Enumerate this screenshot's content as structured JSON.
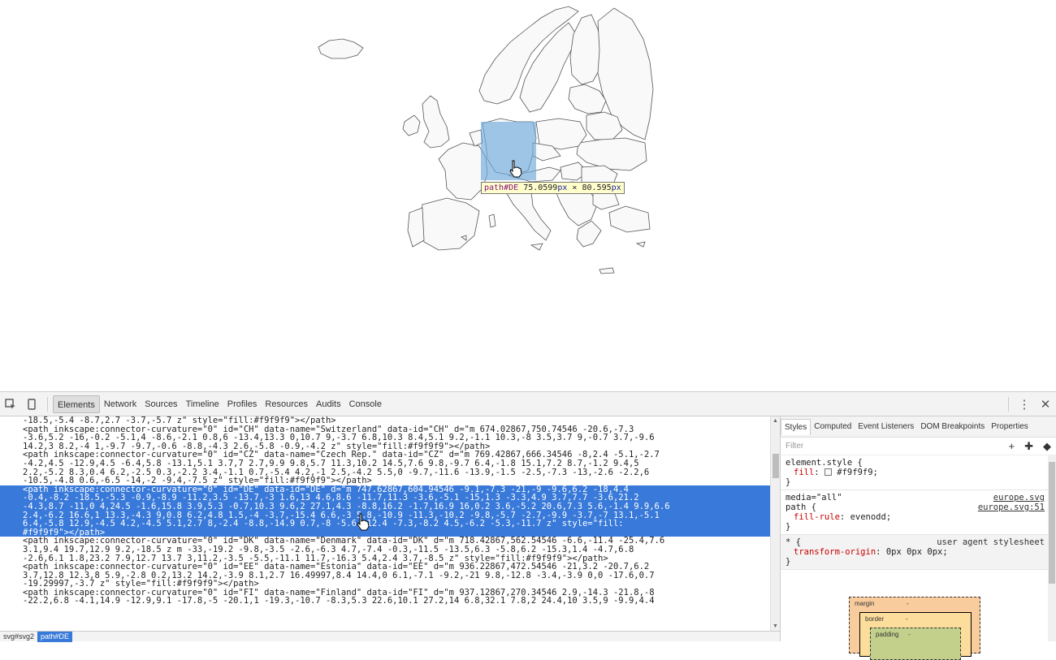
{
  "tooltip": {
    "tag": "path#DE",
    "width": "75.0599",
    "px1": "px",
    "times": "×",
    "height": "80.595",
    "px2": "px"
  },
  "toolbar": {
    "tabs": [
      "Elements",
      "Network",
      "Sources",
      "Timeline",
      "Profiles",
      "Resources",
      "Audits",
      "Console"
    ],
    "active_tab": "Elements",
    "icons": {
      "inspect": "inspect-icon",
      "device": "device-mode-icon",
      "more": "more-vert-icon",
      "close": "close-icon"
    }
  },
  "dom_lines": [
    {
      "text": "-18.5,-5.4 -8.7,2.7 -3.7,-5.7 z\" style=\"fill:#f9f9f9\"></path>",
      "selected": false
    },
    {
      "text": "<path inkscape:connector-curvature=\"0\" id=\"CH\" data-name=\"Switzerland\" data-id=\"CH\" d=\"m 674.02867,750.74546 -20.6,-7.3",
      "selected": false
    },
    {
      "text": "-3.6,5.2 -16,-0.2 -5.1,4 -8.6,-2.1 0.8,6 -13.4,13.3 0,10.7 9,-3.7 6.8,10.3 8.4,5.1 9.2,-1.1 10.3,-8 3.5,3.7 9,-0.7 3.7,-9.6",
      "selected": false
    },
    {
      "text": "14.2,3 8.2,-4 1,-9.7 -9.7,-0.6 -8.8,-4.3 2.6,-5.8 -0.9,-4.2 z\" style=\"fill:#f9f9f9\"></path>",
      "selected": false
    },
    {
      "text": "<path inkscape:connector-curvature=\"0\" id=\"CZ\" data-name=\"Czech Rep.\" data-id=\"CZ\" d=\"m 769.42867,666.34546 -8,2.4 -5.1,-2.7",
      "selected": false
    },
    {
      "text": "-4.2,4.5 -12.9,4.5 -6.4,5.8 -13.1,5.1 3.7,7 2.7,9.9 9.8,5.7 11.3,10.2 14.5,7.6 9.8,-9.7 6.4,-1.8 15.1,7.2 8.7,-1.2 9.4,5",
      "selected": false
    },
    {
      "text": "2.2,-5.2 8.3,0.4 6.2,-2.5 0.3,-2.2 3.4,-1.1 0.7,-5.4 4.2,-1 2.5,-4.2 5.5,0 -9.7,-11.6 -13.9,-1.5 -2.5,-7.3 -13,-2.6 -2.2,6",
      "selected": false
    },
    {
      "text": "-10.5,-4.8 0.6,-6.5 -14,-2 -9.4,-7.5 z\" style=\"fill:#f9f9f9\"></path>",
      "selected": false
    },
    {
      "text": "<path inkscape:connector-curvature=\"0\" id=\"DE\" data-id=\"DE\" d=\"m 747.62867,604.94546 -9.1,-7.3 -21,-9 -9.6,6.2 -18,4.4",
      "selected": true
    },
    {
      "text": "-0.4,-8.2 -18.5,-5.3 -0.9,-8.9 -11.2,3.5 -13.7,-3 1.6,13 4.6,8.6 -11.7,11.3 -3.6,-5.1 -15,1.3 -3.3,4.9 3.7,7.7 -3.6,21.2",
      "selected": true
    },
    {
      "text": "-4.3,8.7 -11,0 4,24.5 -1.6,15.8 3.9,5.3 -0.7,10.3 9.6,2 27.1,4.3 -8.8,16.2 -1.7,16.9 16,0.2 3.6,-5.2 20.6,7.3 5.6,-1.4 9.9,6.6",
      "selected": true
    },
    {
      "text": "2.4,-6.2 16.6,1 13.3,-4.3 9,0.8 6.2,4.8 1.5,-4 -3.7,-15.4 6.6,-3 5.8,-10.9 -11.3,-10.2 -9.8,-5.7 -2.7,-9.9 -3.7,-7 13.1,-5.1",
      "selected": true
    },
    {
      "text": "6.4,-5.8 12.9,-4.5 4.2,-4.5 5.1,2.7 8,-2.4 -8.8,-14.9 0.7,-8 -5.6,-12.4 -7.3,-8.2 4.5,-6.2 -5.3,-11.7 z\" style=\"fill:",
      "selected": true
    },
    {
      "text": "#f9f9f9\"></path>",
      "selected": true
    },
    {
      "text": "<path inkscape:connector-curvature=\"0\" id=\"DK\" data-name=\"Denmark\" data-id=\"DK\" d=\"m 718.42867,562.54546 -6.6,-11.4 -25.4,7.6",
      "selected": false
    },
    {
      "text": "3.1,9.4 19.7,12.9 9.2,-18.5 z m -33,-19.2 -9.8,-3.5 -2.6,-6.3 4.7,-7.4 -0.3,-11.5 -13.5,6.3 -5.8,6.2 -15.3,1.4 -4.7,6.8",
      "selected": false
    },
    {
      "text": "-2.6,6.1 1.8,23.2 7.9,12.7 13.7 3,11.2,-3.5 -5.5,-11.1 11.7,-16.3 5.4,2.4 3.7,-8.5 z\" style=\"fill:#f9f9f9\"></path>",
      "selected": false
    },
    {
      "text": "<path inkscape:connector-curvature=\"0\" id=\"EE\" data-name=\"Estonia\" data-id=\"EE\" d=\"m 936.22867,472.54546 -21,3.2 -20.7,6.2",
      "selected": false
    },
    {
      "text": "3.7,12.8 12.3,8 5.9,-2.8 0.2,13.2 14.2,-3.9 8.1,2.7 16.49997,8.4 14.4,0 6.1,-7.1 -9.2,-21 9.8,-12.8 -3.4,-3.9 0,0 -17.6,0.7",
      "selected": false
    },
    {
      "text": "-19.29997,-3.7 z\" style=\"fill:#f9f9f9\"></path>",
      "selected": false
    },
    {
      "text": "<path inkscape:connector-curvature=\"0\" id=\"FI\" data-name=\"Finland\" data-id=\"FI\" d=\"m 937.12867,270.34546 2.9,-14.3 -21.8,-8",
      "selected": false
    },
    {
      "text": "-22.2,6.8 -4.1,14.9 -12.9,9.1 -17.8,-5 -20.1,1 -19.3,-10.7 -8.3,5.3 22.6,10.1 27.2,14 6.8,32.1 7.8,2 24.4,10 3.5,9 -9.9,4.4",
      "selected": false
    }
  ],
  "breadcrumbs": [
    "svg#svg2",
    "path#DE"
  ],
  "sidebar": {
    "tabs": [
      "Styles",
      "Computed",
      "Event Listeners",
      "DOM Breakpoints",
      "Properties"
    ],
    "active_tab": "Styles",
    "filter_placeholder": "Filter",
    "rule1": {
      "selector": "element.style {",
      "prop": "fill",
      "value": "#f9f9f9;",
      "close": "}"
    },
    "rule2": {
      "media": "media=\"all\"",
      "selector": "path {",
      "prop": "fill-rule",
      "value": "evenodd;",
      "close": "}",
      "src1": "europe.svg",
      "src2": "europe.svg:51"
    },
    "rule3": {
      "selector": "* {",
      "ua": "user agent stylesheet",
      "prop": "transform-origin",
      "value": "0px 0px 0px;",
      "close": "}"
    },
    "box_model": {
      "margin": "margin",
      "margin_val": "-",
      "border": "border",
      "border_val": "-",
      "padding": "padding",
      "padding_val": "-"
    }
  }
}
